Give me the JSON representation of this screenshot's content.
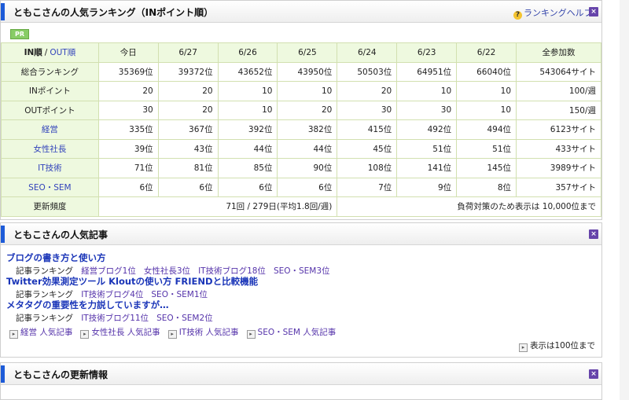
{
  "ranking": {
    "title": "ともこさんの人気ランキング（INポイント順）",
    "help": "ランキングヘルプ",
    "pr": "PR",
    "header_in": "IN順",
    "header_sep": "/",
    "header_out": "OUT順",
    "dates": [
      "今日",
      "6/27",
      "6/26",
      "6/25",
      "6/24",
      "6/23",
      "6/22"
    ],
    "total_label": "全参加数",
    "rows": [
      {
        "label": "総合ランキング",
        "link": false,
        "values": [
          "35369位",
          "39372位",
          "43652位",
          "43950位",
          "50503位",
          "64951位",
          "66040位"
        ],
        "total": "543064サイト"
      },
      {
        "label": "INポイント",
        "link": false,
        "values": [
          "20",
          "20",
          "10",
          "10",
          "20",
          "10",
          "10"
        ],
        "total": "100/週"
      },
      {
        "label": "OUTポイント",
        "link": false,
        "values": [
          "30",
          "20",
          "10",
          "20",
          "30",
          "30",
          "10"
        ],
        "total": "150/週"
      },
      {
        "label": "経営",
        "link": true,
        "values": [
          "335位",
          "367位",
          "392位",
          "382位",
          "415位",
          "492位",
          "494位"
        ],
        "total": "6123サイト"
      },
      {
        "label": "女性社長",
        "link": true,
        "values": [
          "39位",
          "43位",
          "44位",
          "44位",
          "45位",
          "51位",
          "51位"
        ],
        "total": "433サイト"
      },
      {
        "label": "IT技術",
        "link": true,
        "values": [
          "71位",
          "81位",
          "85位",
          "90位",
          "108位",
          "141位",
          "145位"
        ],
        "total": "3989サイト"
      },
      {
        "label": "SEO・SEM",
        "link": true,
        "values": [
          "6位",
          "6位",
          "6位",
          "6位",
          "7位",
          "9位",
          "8位"
        ],
        "total": "357サイト"
      }
    ],
    "freq_label": "更新頻度",
    "freq_value": "71回 / 279日(平均1.8回/週)",
    "load_note": "負荷対策のため表示は 10,000位まで"
  },
  "articles": {
    "title": "ともこさんの人気記事",
    "rank_label": "記事ランキング",
    "items": [
      {
        "title": "ブログの書き方と使い方",
        "ranks": [
          "経営ブログ1位",
          "女性社長3位",
          "IT技術ブログ18位",
          "SEO・SEM3位"
        ]
      },
      {
        "title": "Twitter効果測定ツール Kloutの使い方 FRIENDと比較機能",
        "ranks": [
          "IT技術ブログ4位",
          "SEO・SEM1位"
        ]
      },
      {
        "title": "メタタグの重要性を力説していますが…",
        "ranks": [
          "IT技術ブログ11位",
          "SEO・SEM2位"
        ]
      }
    ],
    "categories": [
      "経営 人気記事",
      "女性社長 人気記事",
      "IT技術 人気記事",
      "SEO・SEM 人気記事"
    ],
    "more": "表示は100位まで"
  },
  "updates": {
    "title": "ともこさんの更新情報"
  },
  "icons": {
    "close": "close-icon",
    "help": "help-icon",
    "arrow": "arrow-right-icon"
  },
  "colors": {
    "accent_blue": "#1d5bd8",
    "close_purple": "#6644aa",
    "table_header_bg": "#eef9df",
    "link_blue": "#3344bb"
  }
}
